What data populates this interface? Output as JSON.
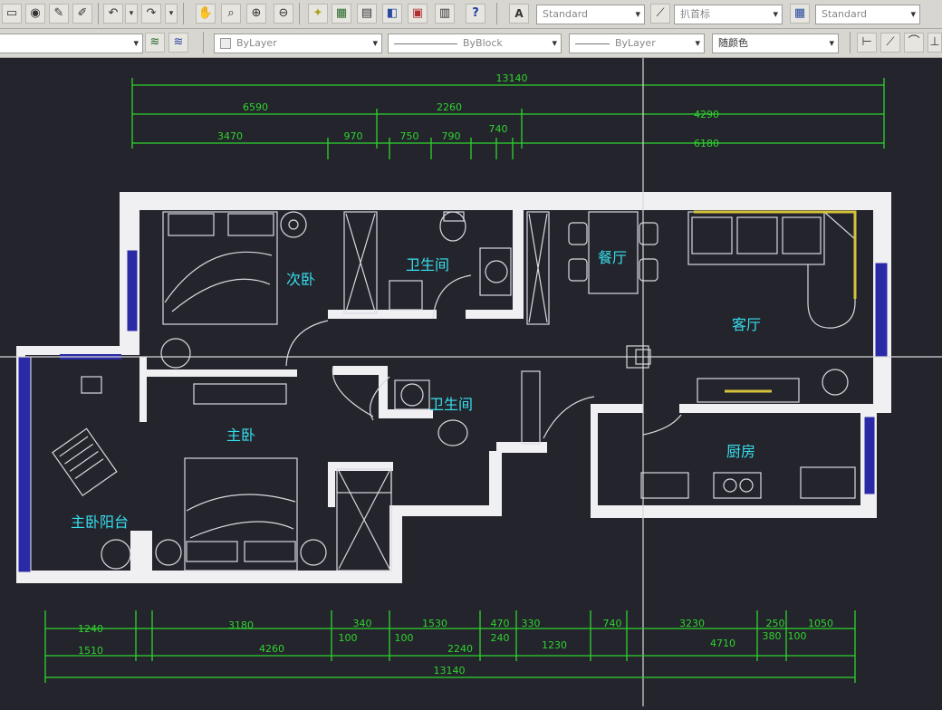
{
  "toolbar_top": {
    "text_style": "Standard",
    "dim_style": "扒首标",
    "table_style": "Standard"
  },
  "toolbar_props": {
    "layer": "ByLayer",
    "linetype": "ByBlock",
    "lineweight": "ByLayer",
    "plot_style": "随颜色"
  },
  "rooms": {
    "second_bedroom": "次卧",
    "bathroom_1": "卫生间",
    "dining": "餐厅",
    "living": "客厅",
    "master_bedroom": "主卧",
    "bathroom_2": "卫生间",
    "kitchen": "厨房",
    "master_balcony": "主卧阳台"
  },
  "dimensions": {
    "top_overall": "13140",
    "top_row2": [
      "6590",
      "2260",
      "4290"
    ],
    "top_row3": [
      "3470",
      "970",
      "750",
      "790",
      "740",
      "6180"
    ],
    "bottom_row1": [
      "1240",
      "3180",
      "340",
      "1530",
      "470",
      "330",
      "740",
      "3230",
      "250",
      "1050"
    ],
    "bottom_row2": [
      "1510",
      "4260",
      "100",
      "100",
      "2240",
      "240",
      "1230",
      "4710",
      "380",
      "100"
    ],
    "bottom_overall": "13140"
  },
  "colors": {
    "canvas": "#24242c",
    "wall": "#f0f0f3",
    "dimension": "#2ed42e",
    "room_label": "#36e0ee",
    "window": "#2a2aa6",
    "furniture": "#d9d9e0",
    "crosshair": "#d8d8d8"
  },
  "icons": [
    "layer-icon",
    "zoom-icon",
    "help-icon",
    "undo-icon",
    "redo-icon",
    "calculator-icon"
  ]
}
